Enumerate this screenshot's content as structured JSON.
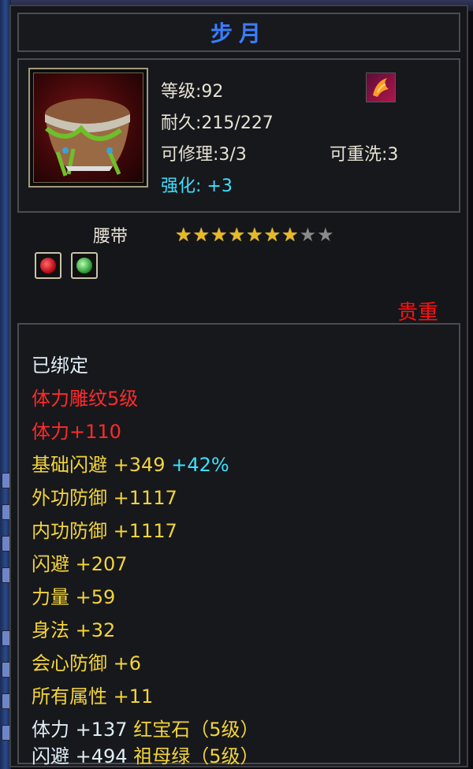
{
  "title": "步月",
  "info": {
    "level": "等级:92",
    "durability": "耐久:215/227",
    "repairable": "可修理:3/3",
    "rewashable": "可重洗:3",
    "enhance_label": "强化:",
    "enhance_value": "+3"
  },
  "item": {
    "type_name": "腰带",
    "stars_filled": 7,
    "stars_total": 9,
    "rarity": "贵重",
    "gems": [
      "ruby-gem-icon",
      "emerald-gem-icon"
    ]
  },
  "attributes": {
    "bound": "已绑定",
    "carving": "体力雕纹5级",
    "stamina": "体力+110",
    "base_dodge_label": "基础闪避",
    "base_dodge_value": "+349",
    "base_dodge_pct": "+42%",
    "ext_def_label": "外功防御",
    "ext_def_value": "+1117",
    "int_def_label": "内功防御",
    "int_def_value": "+1117",
    "dodge_label": "闪避",
    "dodge_value": "+207",
    "strength_label": "力量",
    "strength_value": "+59",
    "agility_label": "身法",
    "agility_value": "+32",
    "crit_def_label": "会心防御",
    "crit_def_value": "+6",
    "all_attr_label": "所有属性",
    "all_attr_value": "+11",
    "gem1_stat_label": "体力",
    "gem1_stat_value": "+137",
    "gem1_name": "红宝石（5级）",
    "gem2_stat_label": "闪避",
    "gem2_stat_value": "+494",
    "gem2_name": "祖母绿（5级）"
  },
  "colors": {
    "title": "#3a7dff",
    "red": "#ff2a2a",
    "gold": "#f2d43a",
    "cyan": "#3ee0ff",
    "star_on": "#e8b825",
    "star_off": "#8a8a8a"
  }
}
